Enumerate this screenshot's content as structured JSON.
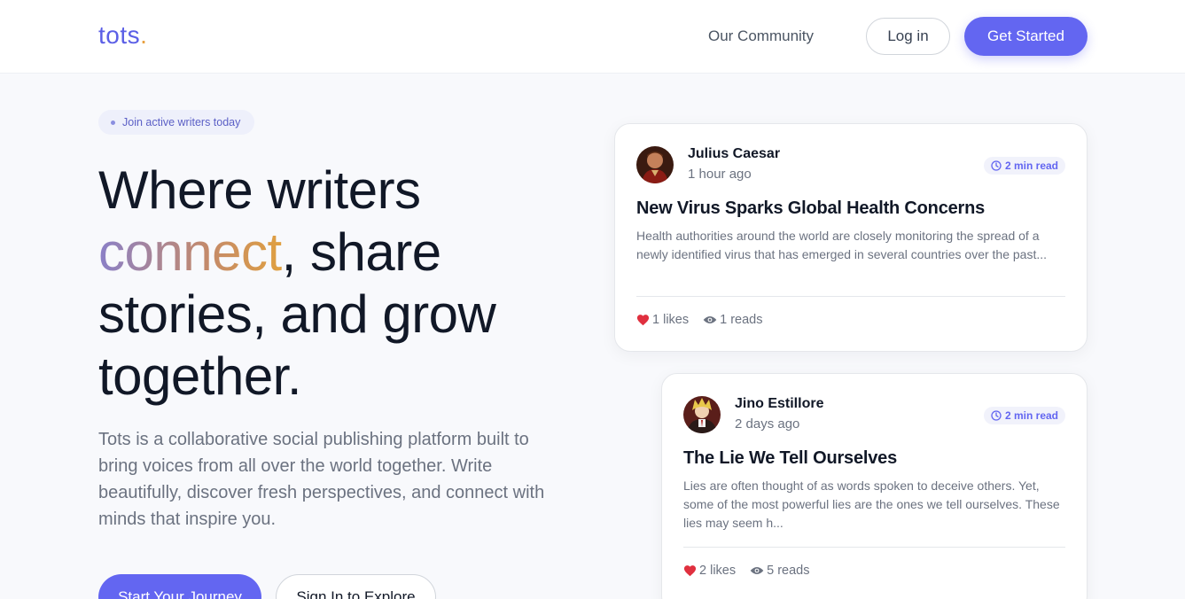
{
  "header": {
    "logo": "tots",
    "logo_dot": ".",
    "nav_community": "Our Community",
    "login_label": "Log in",
    "get_started_label": "Get Started"
  },
  "hero": {
    "badge": "Join active writers today",
    "title_line1": "Where writers",
    "title_accent": "connect",
    "title_after_accent": ", share",
    "title_line3": "stories, and grow",
    "title_line4": "together.",
    "description": "Tots is a collaborative social publishing platform built to bring voices from all over the world together. Write beautifully, discover fresh perspectives, and connect with minds that inspire you.",
    "primary_cta": "Start Your Journey",
    "secondary_cta": "Sign In to Explore"
  },
  "posts": [
    {
      "author": "Julius Caesar",
      "time": "1 hour ago",
      "read_time": "2 min read",
      "title": "New Virus Sparks Global Health Concerns",
      "excerpt": "Health authorities around the world are closely monitoring the spread of a newly identified virus that has emerged in several countries over the past...",
      "likes": "1 likes",
      "reads": "1 reads"
    },
    {
      "author": "Jino Estillore",
      "time": "2 days ago",
      "read_time": "2 min read",
      "title": "The Lie We Tell Ourselves",
      "excerpt": "Lies are often thought of as words spoken to deceive others. Yet, some of the most powerful lies are the ones we tell ourselves. These lies may seem h...",
      "likes": "2 likes",
      "reads": "5 reads"
    }
  ],
  "colors": {
    "brand": "#6366f1",
    "logo_dot": "#e8a040",
    "heart": "#e0303f"
  }
}
